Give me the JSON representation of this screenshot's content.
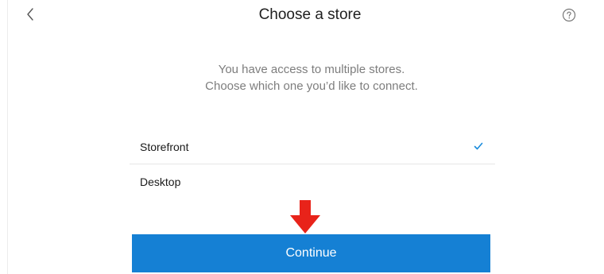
{
  "header": {
    "title": "Choose a store",
    "back_icon": "chevron-left-icon",
    "help_icon": "help-circle-icon"
  },
  "subtitle": {
    "line1": "You have access to multiple stores.",
    "line2": "Choose which one you’d like to connect."
  },
  "stores": [
    {
      "label": "Storefront",
      "selected": true
    },
    {
      "label": "Desktop",
      "selected": false
    }
  ],
  "annotation": {
    "icon": "red-down-arrow-icon",
    "color": "#e8231a"
  },
  "actions": {
    "continue_label": "Continue"
  },
  "colors": {
    "accent": "#1580d4",
    "check": "#1a8bdc",
    "subtitle_text": "#7d7d7d"
  }
}
